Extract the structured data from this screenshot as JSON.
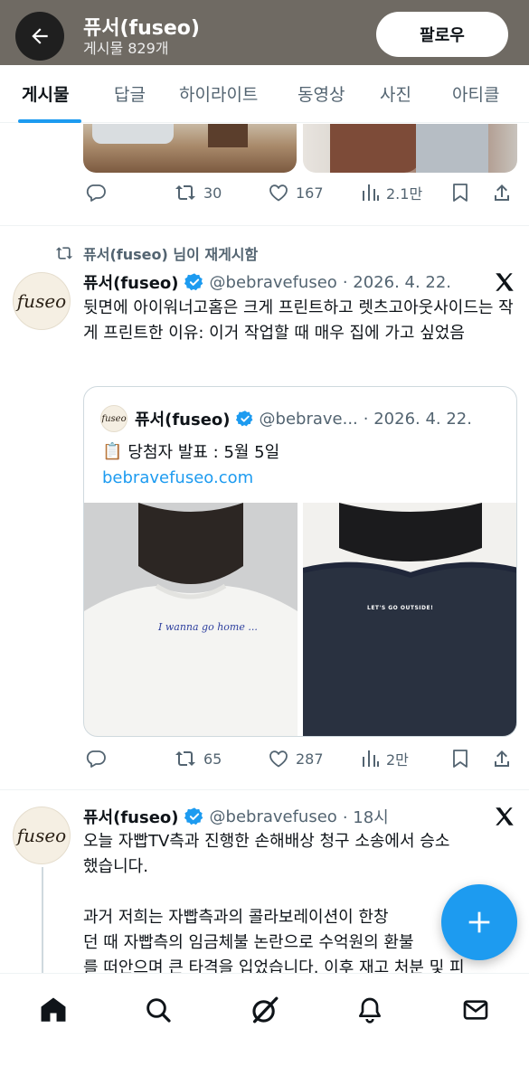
{
  "header": {
    "title": "퓨서(fuseo)",
    "post_count": "게시물 829개",
    "follow_label": "팔로우"
  },
  "tabs": [
    {
      "label": "게시물",
      "active": true
    },
    {
      "label": "답글",
      "active": false
    },
    {
      "label": "하이라이트",
      "active": false
    },
    {
      "label": "동영상",
      "active": false
    },
    {
      "label": "사진",
      "active": false
    },
    {
      "label": "아티클",
      "active": false
    }
  ],
  "tweet1": {
    "stats": {
      "replies": "",
      "reposts": "30",
      "likes": "167",
      "views": "2.1만"
    }
  },
  "tweet2": {
    "repost_label": "퓨서(fuseo) 님이 재게시함",
    "avatar_logo": "fuseo",
    "name": "퓨서(fuseo)",
    "handle": "@bebravefuseo",
    "date": "· 2026. 4. 22.",
    "text": "뒷면에 아이워너고홈은 크게 프린트하고 렛츠고아웃사이드는 작게 프린트한 이유: 이거 작업할 때 매우 집에 가고 싶었음",
    "quote": {
      "name": "퓨서(fuseo)",
      "handle": "@bebrave...",
      "date": "· 2026. 4. 22.",
      "emoji": "📋",
      "text": "당첨자 발표 : 5월 5일",
      "link": "bebravefuseo.com",
      "image_left_print": "I wanna go home ...",
      "image_right_print": "LET'S GO OUTSIDE!"
    },
    "stats": {
      "replies": "",
      "reposts": "65",
      "likes": "287",
      "views": "2만"
    }
  },
  "tweet3": {
    "avatar_logo": "fuseo",
    "name": "퓨서(fuseo)",
    "handle": "@bebravefuseo",
    "date": "· 18시",
    "text_line1": "오늘 자빱TV측과 진행한 손해배상 청구 소송에서 승소",
    "text_line2": "했습니다.",
    "text_line3": "과거 저희는 자빱측과의 콜라보레이션이 한창",
    "text_line4": "던 때 자빱측의 임금체불 논란으로 수억원의 환불",
    "text_line5": "를 떠안으며 큰 타격을 입었습니다. 이후 재고 처분 및 피"
  },
  "colors": {
    "accent": "#1d9bf0",
    "header_bg": "#6f6a63",
    "text_secondary": "#536471",
    "border": "#cfd9de"
  },
  "icons": [
    "back-arrow-icon",
    "reply-icon",
    "repost-icon",
    "like-icon",
    "views-icon",
    "bookmark-icon",
    "share-icon",
    "verified-icon",
    "x-logo-icon",
    "home-icon",
    "search-icon",
    "grok-icon",
    "notifications-icon",
    "messages-icon",
    "compose-plus-icon"
  ]
}
